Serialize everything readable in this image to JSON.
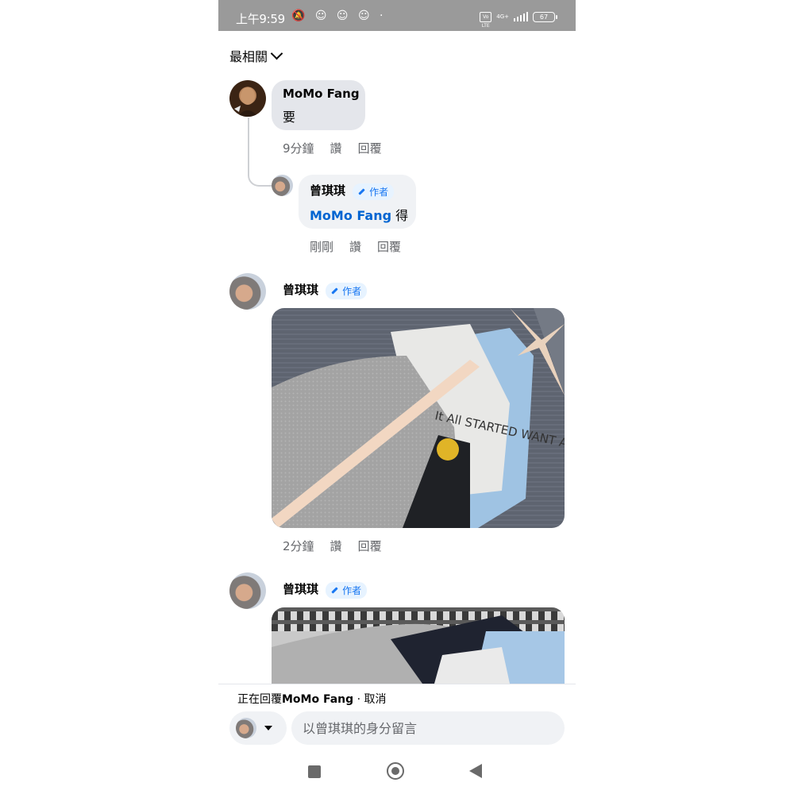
{
  "status_bar": {
    "time": "上午9:59",
    "icons": "🔕 ☺ ☺ ☺ ·",
    "network_type": "4G+",
    "volte_label": "Vo LTE",
    "battery": "67"
  },
  "sort": {
    "label": "最相關"
  },
  "comments": [
    {
      "author": "MoMo Fang",
      "text": "要",
      "time": "9分鐘",
      "like_label": "讚",
      "reply_label": "回覆"
    },
    {
      "author": "曾琪琪",
      "badge": "作者",
      "mention": "MoMo Fang",
      "text": " 得",
      "time": "剛剛",
      "like_label": "讚",
      "reply_label": "回覆"
    },
    {
      "author": "曾琪琪",
      "badge": "作者",
      "time": "2分鐘",
      "like_label": "讚",
      "reply_label": "回覆",
      "photo_text": "It All STARTED WANT A ME"
    },
    {
      "author": "曾琪琪",
      "badge": "作者"
    }
  ],
  "reply_bar": {
    "prefix": "正在回覆",
    "name": "MoMo Fang",
    "separator": " · ",
    "cancel": "取消"
  },
  "composer": {
    "placeholder": "以曾琪琪的身分留言"
  },
  "colors": {
    "accent": "#1877f2",
    "mention": "#0064d1",
    "bubble": "#f0f2f5",
    "meta_text": "#65676b"
  }
}
